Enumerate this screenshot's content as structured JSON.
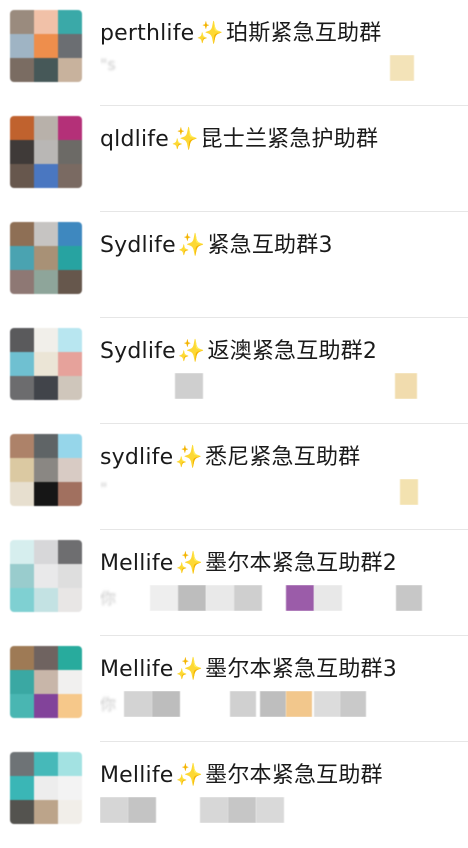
{
  "chats": [
    {
      "name": "perthlife",
      "emoji": "✨",
      "suffix": "珀斯紧急互助群",
      "preview": "\"s",
      "avatar_colors": [
        "#9a8b7e",
        "#f1c1a8",
        "#3aa9a8",
        "#9fb4c4",
        "#ee8e4c",
        "#6b6e72",
        "#7a6c62",
        "#465858",
        "#c8b29d"
      ]
    },
    {
      "name": "qldlife",
      "emoji": "✨",
      "suffix": "昆士兰紧急护助群",
      "preview": "",
      "avatar_colors": [
        "#c0622e",
        "#b8b1aa",
        "#b43078",
        "#3f3a38",
        "#b9b7b5",
        "#6c6a66",
        "#67574d",
        "#4a77c1",
        "#7a6a62"
      ]
    },
    {
      "name": "Sydlife",
      "emoji": "✨",
      "suffix": "紧急互助群3",
      "preview": "",
      "avatar_colors": [
        "#8e6f55",
        "#c6c4c2",
        "#3e88bf",
        "#4aa3b1",
        "#a89176",
        "#27a3a1",
        "#8e7874",
        "#8ea59a",
        "#66574c"
      ]
    },
    {
      "name": "Sydlife",
      "emoji": "✨",
      "suffix": "返澳紧急互助群2",
      "preview": "",
      "avatar_colors": [
        "#5a5a5c",
        "#f1efea",
        "#b8e6f0",
        "#6fc0d1",
        "#ebe5d6",
        "#e6a29b",
        "#6c6c6e",
        "#41444a",
        "#cfc6bb"
      ]
    },
    {
      "name": "sydlife",
      "emoji": "✨",
      "suffix": "悉尼紧急互助群",
      "preview": "\"",
      "avatar_colors": [
        "#ad8269",
        "#5f6466",
        "#96d6ea",
        "#dbc9a2",
        "#8a8783",
        "#d8cbc4",
        "#e7dfcf",
        "#161616",
        "#a1705f"
      ]
    },
    {
      "name": "Mellife",
      "emoji": "✨",
      "suffix": "墨尔本紧急互助群2",
      "preview": "你",
      "avatar_colors": [
        "#d6eeee",
        "#d7d7d9",
        "#6e6e70",
        "#99cccd",
        "#e9e9ea",
        "#dedede",
        "#7fd0d2",
        "#c3e2e3",
        "#e8e6e5"
      ]
    },
    {
      "name": "Mellife",
      "emoji": "✨",
      "suffix": "墨尔本紧急互助群3",
      "preview": "你",
      "avatar_colors": [
        "#9e7a55",
        "#6f6360",
        "#28ab9d",
        "#3aa8a3",
        "#c8b6a9",
        "#f1f0ef",
        "#49b6b2",
        "#82439a",
        "#f6c88a"
      ]
    },
    {
      "name": "Mellife",
      "emoji": "✨",
      "suffix": "墨尔本紧急互助群",
      "preview": "",
      "avatar_colors": [
        "#6e7376",
        "#46b9b9",
        "#a3e2e2",
        "#3ab6b6",
        "#ededed",
        "#f3f3f3",
        "#54534f",
        "#bca48a",
        "#f1eee9"
      ]
    }
  ]
}
